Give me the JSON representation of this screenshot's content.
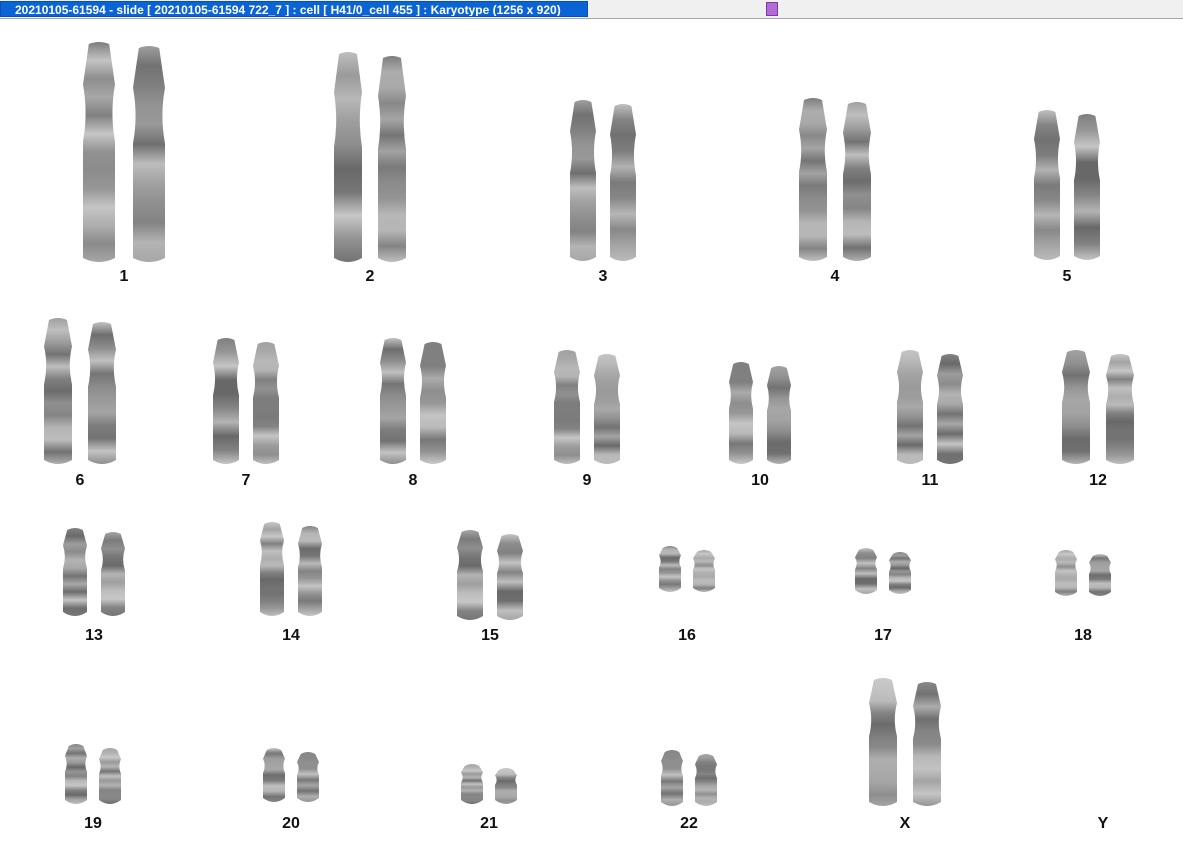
{
  "window": {
    "title": "20210105-61594 - slide [ 20210105-61594 722_7 ] : cell [ H41/0_cell 455 ] : Karyotype  (1256 x 920)",
    "title_bg": "#0a64d6",
    "handle_color": "#b26ad6"
  },
  "karyotype": {
    "chromosomes": [
      {
        "id": "1",
        "label": "1"
      },
      {
        "id": "2",
        "label": "2"
      },
      {
        "id": "3",
        "label": "3"
      },
      {
        "id": "4",
        "label": "4"
      },
      {
        "id": "5",
        "label": "5"
      },
      {
        "id": "6",
        "label": "6"
      },
      {
        "id": "7",
        "label": "7"
      },
      {
        "id": "8",
        "label": "8"
      },
      {
        "id": "9",
        "label": "9"
      },
      {
        "id": "10",
        "label": "10"
      },
      {
        "id": "11",
        "label": "11"
      },
      {
        "id": "12",
        "label": "12"
      },
      {
        "id": "13",
        "label": "13"
      },
      {
        "id": "14",
        "label": "14"
      },
      {
        "id": "15",
        "label": "15"
      },
      {
        "id": "16",
        "label": "16"
      },
      {
        "id": "17",
        "label": "17"
      },
      {
        "id": "18",
        "label": "18"
      },
      {
        "id": "19",
        "label": "19"
      },
      {
        "id": "20",
        "label": "20"
      },
      {
        "id": "21",
        "label": "21"
      },
      {
        "id": "22",
        "label": "22"
      },
      {
        "id": "X",
        "label": "X"
      },
      {
        "id": "Y",
        "label": "Y"
      }
    ]
  }
}
